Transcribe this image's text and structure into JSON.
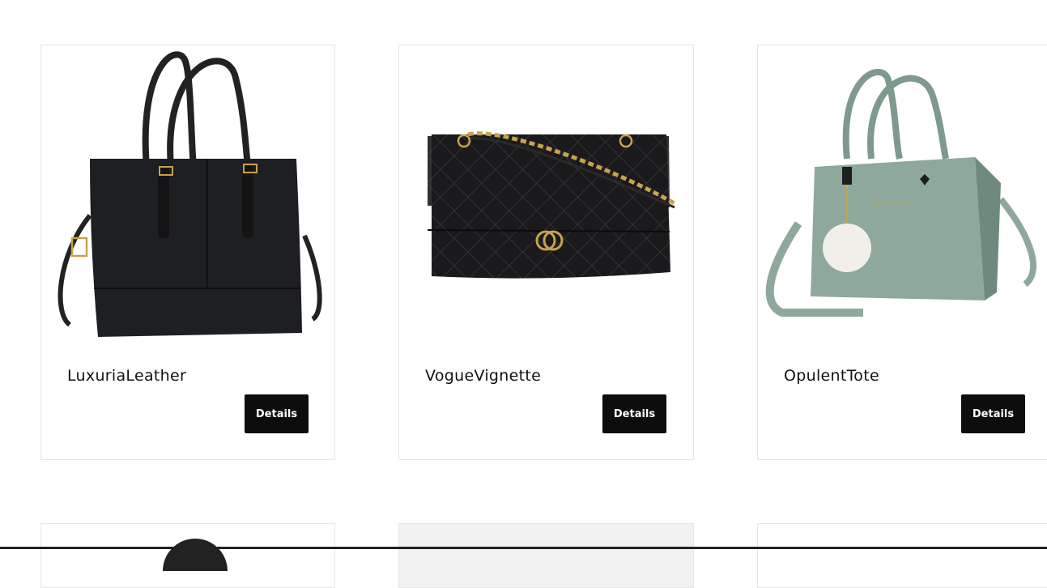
{
  "products": [
    {
      "name": "LuxuriaLeather",
      "button_label": "Details"
    },
    {
      "name": "VogueVignette",
      "button_label": "Details"
    },
    {
      "name": "OpulentTote",
      "button_label": "Details"
    }
  ],
  "colors": {
    "button_bg": "#0d0d0d",
    "card_border": "#e6e6e6",
    "bag_black": "#1e1f22",
    "bag_green": "#8fa89c",
    "hardware_gold": "#c9a24b"
  }
}
